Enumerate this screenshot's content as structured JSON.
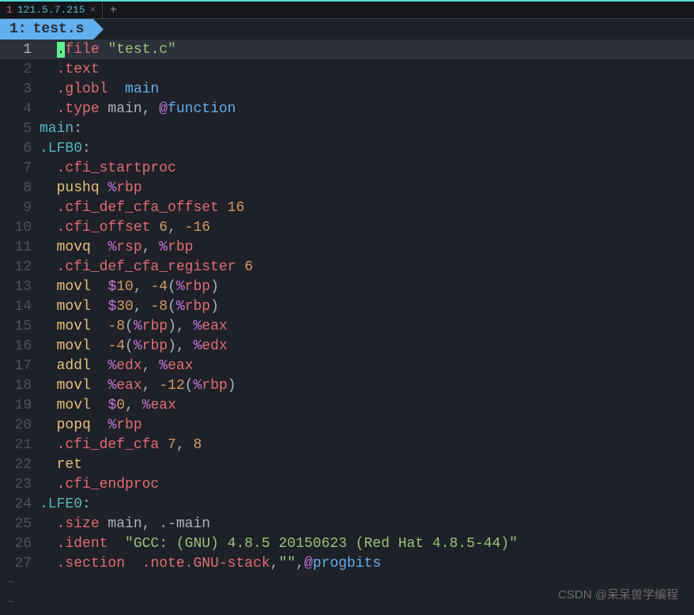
{
  "tab": {
    "num": "1",
    "name": "121.5.7.215",
    "close": "×",
    "add": "+"
  },
  "buffer": {
    "num": "1:",
    "name": "test.s"
  },
  "lines": [
    {
      "n": "1",
      "highlight": true,
      "tokens": [
        {
          "t": "  ",
          "c": "text"
        },
        {
          "t": ".",
          "c": "cursor"
        },
        {
          "t": "file ",
          "c": "directive"
        },
        {
          "t": "\"test.c\"",
          "c": "string"
        }
      ]
    },
    {
      "n": "2",
      "tokens": [
        {
          "t": "  ",
          "c": "text"
        },
        {
          "t": ".text",
          "c": "directive"
        }
      ]
    },
    {
      "n": "3",
      "tokens": [
        {
          "t": "  ",
          "c": "text"
        },
        {
          "t": ".globl",
          "c": "directive"
        },
        {
          "t": "  main",
          "c": "func"
        }
      ]
    },
    {
      "n": "4",
      "tokens": [
        {
          "t": "  ",
          "c": "text"
        },
        {
          "t": ".type",
          "c": "directive"
        },
        {
          "t": " main",
          "c": "text"
        },
        {
          "t": ", ",
          "c": "text"
        },
        {
          "t": "@",
          "c": "prefix"
        },
        {
          "t": "function",
          "c": "func"
        }
      ]
    },
    {
      "n": "5",
      "tokens": [
        {
          "t": "main",
          "c": "label"
        },
        {
          "t": ":",
          "c": "text"
        }
      ]
    },
    {
      "n": "6",
      "tokens": [
        {
          "t": ".LFB0",
          "c": "label"
        },
        {
          "t": ":",
          "c": "text"
        }
      ]
    },
    {
      "n": "7",
      "tokens": [
        {
          "t": "  ",
          "c": "text"
        },
        {
          "t": ".cfi_startproc",
          "c": "directive"
        }
      ]
    },
    {
      "n": "8",
      "tokens": [
        {
          "t": "  ",
          "c": "text"
        },
        {
          "t": "pushq",
          "c": "keyword"
        },
        {
          "t": " ",
          "c": "text"
        },
        {
          "t": "%",
          "c": "prefix"
        },
        {
          "t": "rbp",
          "c": "register"
        }
      ]
    },
    {
      "n": "9",
      "tokens": [
        {
          "t": "  ",
          "c": "text"
        },
        {
          "t": ".cfi_def_cfa_offset",
          "c": "directive"
        },
        {
          "t": " ",
          "c": "text"
        },
        {
          "t": "16",
          "c": "number"
        }
      ]
    },
    {
      "n": "10",
      "tokens": [
        {
          "t": "  ",
          "c": "text"
        },
        {
          "t": ".cfi_offset",
          "c": "directive"
        },
        {
          "t": " ",
          "c": "text"
        },
        {
          "t": "6",
          "c": "number"
        },
        {
          "t": ", ",
          "c": "text"
        },
        {
          "t": "-16",
          "c": "number"
        }
      ]
    },
    {
      "n": "11",
      "tokens": [
        {
          "t": "  ",
          "c": "text"
        },
        {
          "t": "movq",
          "c": "keyword"
        },
        {
          "t": "  ",
          "c": "text"
        },
        {
          "t": "%",
          "c": "prefix"
        },
        {
          "t": "rsp",
          "c": "register"
        },
        {
          "t": ", ",
          "c": "text"
        },
        {
          "t": "%",
          "c": "prefix"
        },
        {
          "t": "rbp",
          "c": "register"
        }
      ]
    },
    {
      "n": "12",
      "tokens": [
        {
          "t": "  ",
          "c": "text"
        },
        {
          "t": ".cfi_def_cfa_register",
          "c": "directive"
        },
        {
          "t": " ",
          "c": "text"
        },
        {
          "t": "6",
          "c": "number"
        }
      ]
    },
    {
      "n": "13",
      "tokens": [
        {
          "t": "  ",
          "c": "text"
        },
        {
          "t": "movl",
          "c": "keyword"
        },
        {
          "t": "  ",
          "c": "text"
        },
        {
          "t": "$",
          "c": "prefix"
        },
        {
          "t": "10",
          "c": "number"
        },
        {
          "t": ", ",
          "c": "text"
        },
        {
          "t": "-4",
          "c": "offset"
        },
        {
          "t": "(",
          "c": "text"
        },
        {
          "t": "%",
          "c": "prefix"
        },
        {
          "t": "rbp",
          "c": "register"
        },
        {
          "t": ")",
          "c": "text"
        }
      ]
    },
    {
      "n": "14",
      "tokens": [
        {
          "t": "  ",
          "c": "text"
        },
        {
          "t": "movl",
          "c": "keyword"
        },
        {
          "t": "  ",
          "c": "text"
        },
        {
          "t": "$",
          "c": "prefix"
        },
        {
          "t": "30",
          "c": "number"
        },
        {
          "t": ", ",
          "c": "text"
        },
        {
          "t": "-8",
          "c": "offset"
        },
        {
          "t": "(",
          "c": "text"
        },
        {
          "t": "%",
          "c": "prefix"
        },
        {
          "t": "rbp",
          "c": "register"
        },
        {
          "t": ")",
          "c": "text"
        }
      ]
    },
    {
      "n": "15",
      "tokens": [
        {
          "t": "  ",
          "c": "text"
        },
        {
          "t": "movl",
          "c": "keyword"
        },
        {
          "t": "  ",
          "c": "text"
        },
        {
          "t": "-8",
          "c": "offset"
        },
        {
          "t": "(",
          "c": "text"
        },
        {
          "t": "%",
          "c": "prefix"
        },
        {
          "t": "rbp",
          "c": "register"
        },
        {
          "t": "), ",
          "c": "text"
        },
        {
          "t": "%",
          "c": "prefix"
        },
        {
          "t": "eax",
          "c": "register"
        }
      ]
    },
    {
      "n": "16",
      "tokens": [
        {
          "t": "  ",
          "c": "text"
        },
        {
          "t": "movl",
          "c": "keyword"
        },
        {
          "t": "  ",
          "c": "text"
        },
        {
          "t": "-4",
          "c": "offset"
        },
        {
          "t": "(",
          "c": "text"
        },
        {
          "t": "%",
          "c": "prefix"
        },
        {
          "t": "rbp",
          "c": "register"
        },
        {
          "t": "), ",
          "c": "text"
        },
        {
          "t": "%",
          "c": "prefix"
        },
        {
          "t": "edx",
          "c": "register"
        }
      ]
    },
    {
      "n": "17",
      "tokens": [
        {
          "t": "  ",
          "c": "text"
        },
        {
          "t": "addl",
          "c": "keyword"
        },
        {
          "t": "  ",
          "c": "text"
        },
        {
          "t": "%",
          "c": "prefix"
        },
        {
          "t": "edx",
          "c": "register"
        },
        {
          "t": ", ",
          "c": "text"
        },
        {
          "t": "%",
          "c": "prefix"
        },
        {
          "t": "eax",
          "c": "register"
        }
      ]
    },
    {
      "n": "18",
      "tokens": [
        {
          "t": "  ",
          "c": "text"
        },
        {
          "t": "movl",
          "c": "keyword"
        },
        {
          "t": "  ",
          "c": "text"
        },
        {
          "t": "%",
          "c": "prefix"
        },
        {
          "t": "eax",
          "c": "register"
        },
        {
          "t": ", ",
          "c": "text"
        },
        {
          "t": "-12",
          "c": "offset"
        },
        {
          "t": "(",
          "c": "text"
        },
        {
          "t": "%",
          "c": "prefix"
        },
        {
          "t": "rbp",
          "c": "register"
        },
        {
          "t": ")",
          "c": "text"
        }
      ]
    },
    {
      "n": "19",
      "tokens": [
        {
          "t": "  ",
          "c": "text"
        },
        {
          "t": "movl",
          "c": "keyword"
        },
        {
          "t": "  ",
          "c": "text"
        },
        {
          "t": "$",
          "c": "prefix"
        },
        {
          "t": "0",
          "c": "number"
        },
        {
          "t": ", ",
          "c": "text"
        },
        {
          "t": "%",
          "c": "prefix"
        },
        {
          "t": "eax",
          "c": "register"
        }
      ]
    },
    {
      "n": "20",
      "tokens": [
        {
          "t": "  ",
          "c": "text"
        },
        {
          "t": "popq",
          "c": "keyword"
        },
        {
          "t": "  ",
          "c": "text"
        },
        {
          "t": "%",
          "c": "prefix"
        },
        {
          "t": "rbp",
          "c": "register"
        }
      ]
    },
    {
      "n": "21",
      "tokens": [
        {
          "t": "  ",
          "c": "text"
        },
        {
          "t": ".cfi_def_cfa",
          "c": "directive"
        },
        {
          "t": " ",
          "c": "text"
        },
        {
          "t": "7",
          "c": "number"
        },
        {
          "t": ", ",
          "c": "text"
        },
        {
          "t": "8",
          "c": "number"
        }
      ]
    },
    {
      "n": "22",
      "tokens": [
        {
          "t": "  ",
          "c": "text"
        },
        {
          "t": "ret",
          "c": "keyword"
        }
      ]
    },
    {
      "n": "23",
      "tokens": [
        {
          "t": "  ",
          "c": "text"
        },
        {
          "t": ".cfi_endproc",
          "c": "directive"
        }
      ]
    },
    {
      "n": "24",
      "tokens": [
        {
          "t": ".LFE0",
          "c": "label"
        },
        {
          "t": ":",
          "c": "text"
        }
      ]
    },
    {
      "n": "25",
      "tokens": [
        {
          "t": "  ",
          "c": "text"
        },
        {
          "t": ".size",
          "c": "directive"
        },
        {
          "t": " main, .-main",
          "c": "text"
        }
      ]
    },
    {
      "n": "26",
      "tokens": [
        {
          "t": "  ",
          "c": "text"
        },
        {
          "t": ".ident",
          "c": "directive"
        },
        {
          "t": "  ",
          "c": "text"
        },
        {
          "t": "\"GCC: (GNU) 4.8.5 20150623 (Red Hat 4.8.5-44)\"",
          "c": "string"
        }
      ]
    },
    {
      "n": "27",
      "tokens": [
        {
          "t": "  ",
          "c": "text"
        },
        {
          "t": ".section",
          "c": "directive"
        },
        {
          "t": "  ",
          "c": "text"
        },
        {
          "t": ".note.GNU-stack",
          "c": "directive"
        },
        {
          "t": ",",
          "c": "text"
        },
        {
          "t": "\"\"",
          "c": "string"
        },
        {
          "t": ",",
          "c": "text"
        },
        {
          "t": "@",
          "c": "prefix"
        },
        {
          "t": "progbits",
          "c": "func"
        }
      ]
    }
  ],
  "tildes": [
    "~",
    "~"
  ],
  "watermark": "CSDN @呆呆兽学编程"
}
